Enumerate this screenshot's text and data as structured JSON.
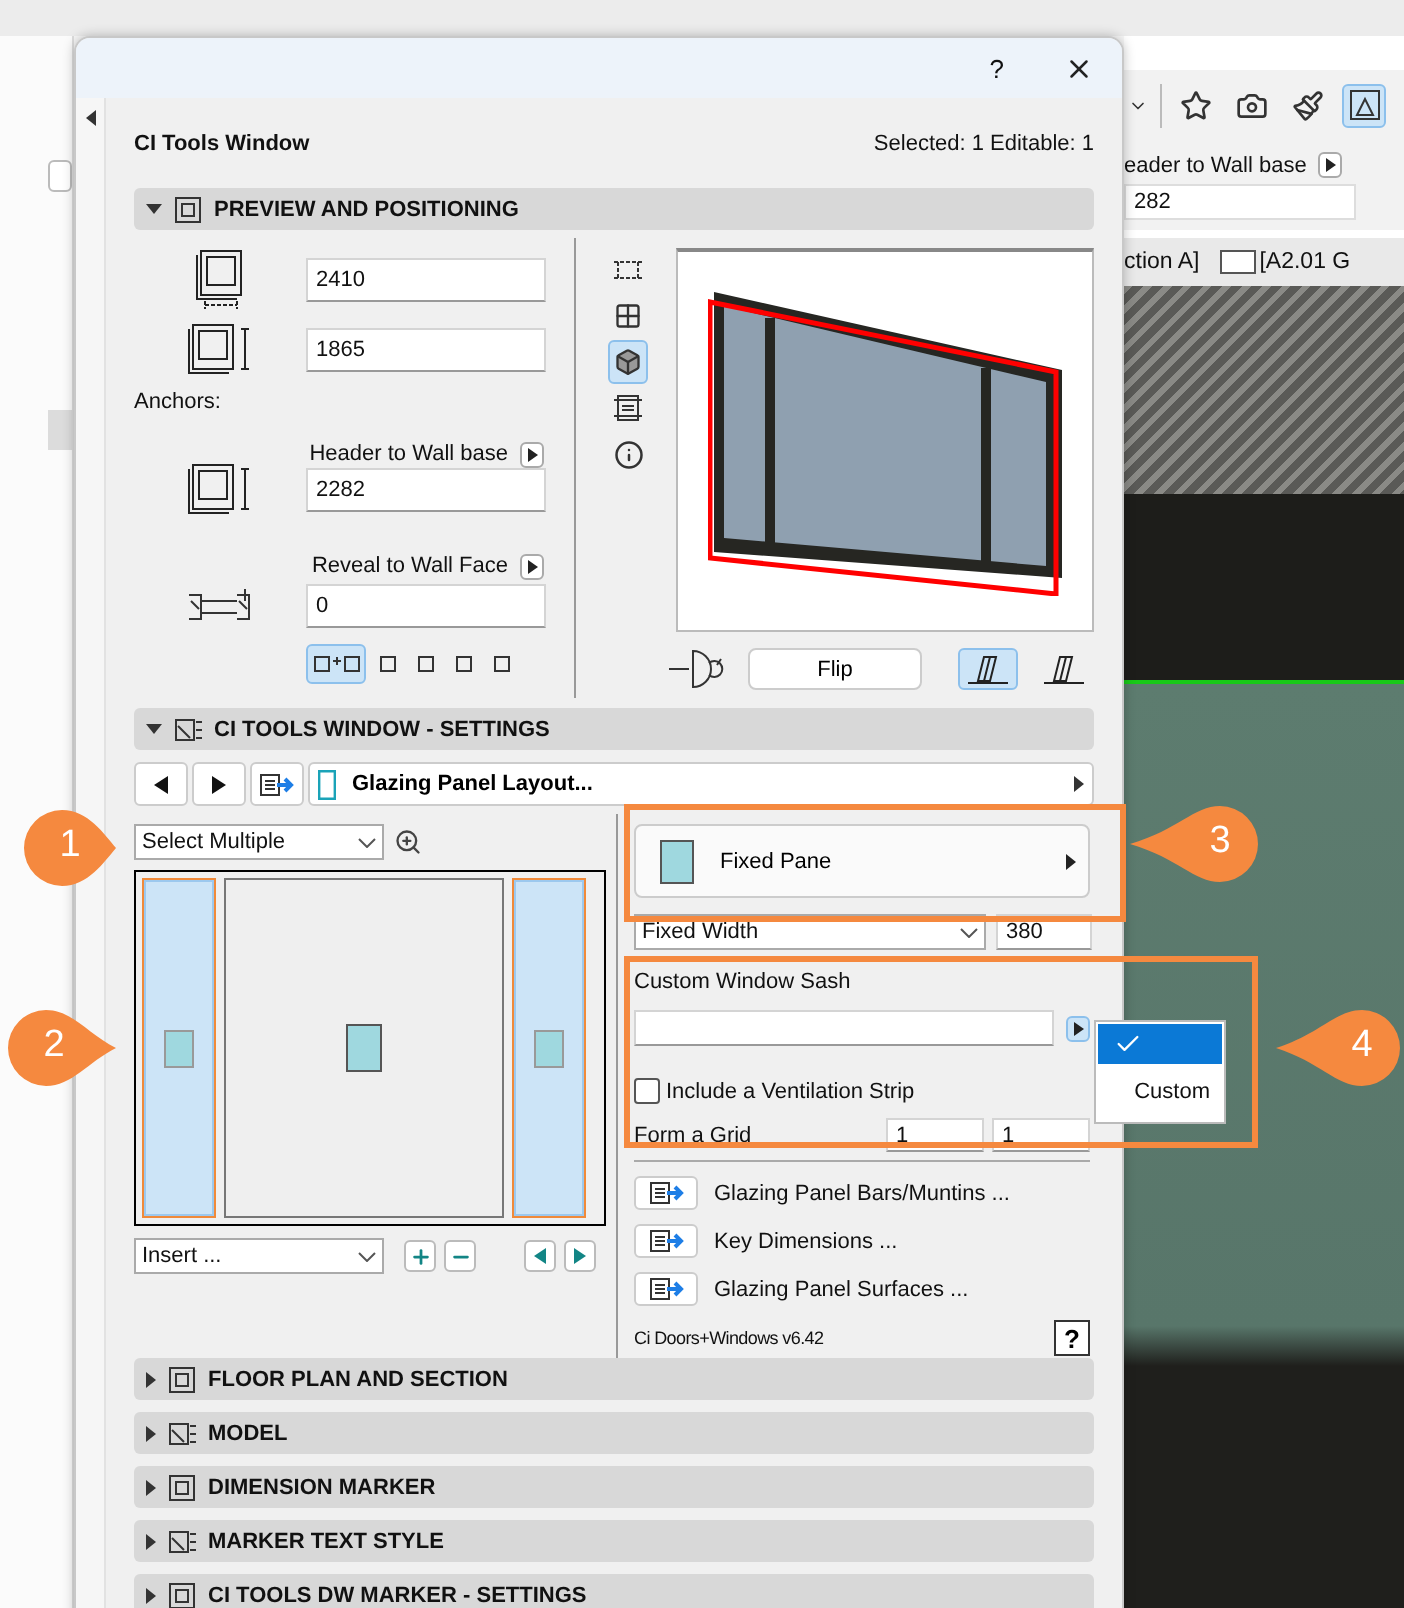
{
  "backdrop": {
    "toolbar_tools": [
      {
        "selected": false
      },
      {
        "selected": false
      },
      {
        "selected": false
      },
      {
        "selected": true
      }
    ],
    "anchor_label": "eader to Wall base",
    "anchor_value": "282",
    "view_tabs": [
      {
        "label": "ction A]"
      },
      {
        "label": "[A2.01 G"
      }
    ]
  },
  "dialog": {
    "help": "?",
    "title": "CI Tools Window",
    "selection_info": "Selected: 1 Editable: 1",
    "sections": [
      {
        "kind": "preview",
        "title": "PREVIEW AND POSITIONING",
        "expanded": true,
        "width_value": "2410",
        "height_value": "1865",
        "anchors_label": "Anchors:",
        "header_label": "Header to Wall base",
        "header_value": "2282",
        "reveal_label": "Reveal to Wall Face",
        "reveal_value": "0",
        "anchor_modes": [
          {
            "selected": true
          },
          {
            "selected": false
          },
          {
            "selected": false
          },
          {
            "selected": false
          },
          {
            "selected": false
          }
        ],
        "view_modes": [
          {
            "selected": false
          },
          {
            "selected": false
          },
          {
            "selected": true
          },
          {
            "selected": false
          },
          {
            "selected": false
          }
        ],
        "flip_label": "Flip",
        "handing": [
          {
            "selected": true
          },
          {
            "selected": false
          }
        ]
      },
      {
        "kind": "settings",
        "title": "CI TOOLS WINDOW - SETTINGS",
        "expanded": true,
        "page": "Glazing Panel Layout...",
        "select_mode": "Select Multiple",
        "panes": [
          {
            "selected": true
          },
          {
            "selected": false
          },
          {
            "selected": true
          }
        ],
        "insert": "Insert ...",
        "pane_type": "Fixed Pane",
        "width_mode": "Fixed Width",
        "width_value": "380",
        "sash_label": "Custom Window Sash",
        "ventilation": {
          "label": "Include a Ventilation Strip",
          "checked": false
        },
        "grid": {
          "label": "Form a Grid",
          "columns": "1",
          "rows": "1"
        },
        "links": [
          "Glazing Panel Bars/Muntins ...",
          "Key Dimensions ...",
          "Glazing Panel Surfaces ..."
        ],
        "version": "Ci Doors+Windows v6.42",
        "help": "?"
      },
      {
        "kind": "plain",
        "title": "FLOOR PLAN AND SECTION",
        "expanded": false
      },
      {
        "kind": "plain",
        "title": "MODEL",
        "expanded": false
      },
      {
        "kind": "plain",
        "title": "DIMENSION MARKER",
        "expanded": false
      },
      {
        "kind": "plain",
        "title": "MARKER TEXT STYLE",
        "expanded": false
      },
      {
        "kind": "plain",
        "title": "CI TOOLS DW MARKER - SETTINGS",
        "expanded": false
      }
    ]
  },
  "sash_menu": {
    "items": [
      {
        "selected": true
      },
      {
        "label": "Custom",
        "selected": false
      }
    ]
  },
  "callouts": [
    {
      "number": "1"
    },
    {
      "number": "2"
    },
    {
      "number": "3"
    },
    {
      "number": "4"
    }
  ]
}
